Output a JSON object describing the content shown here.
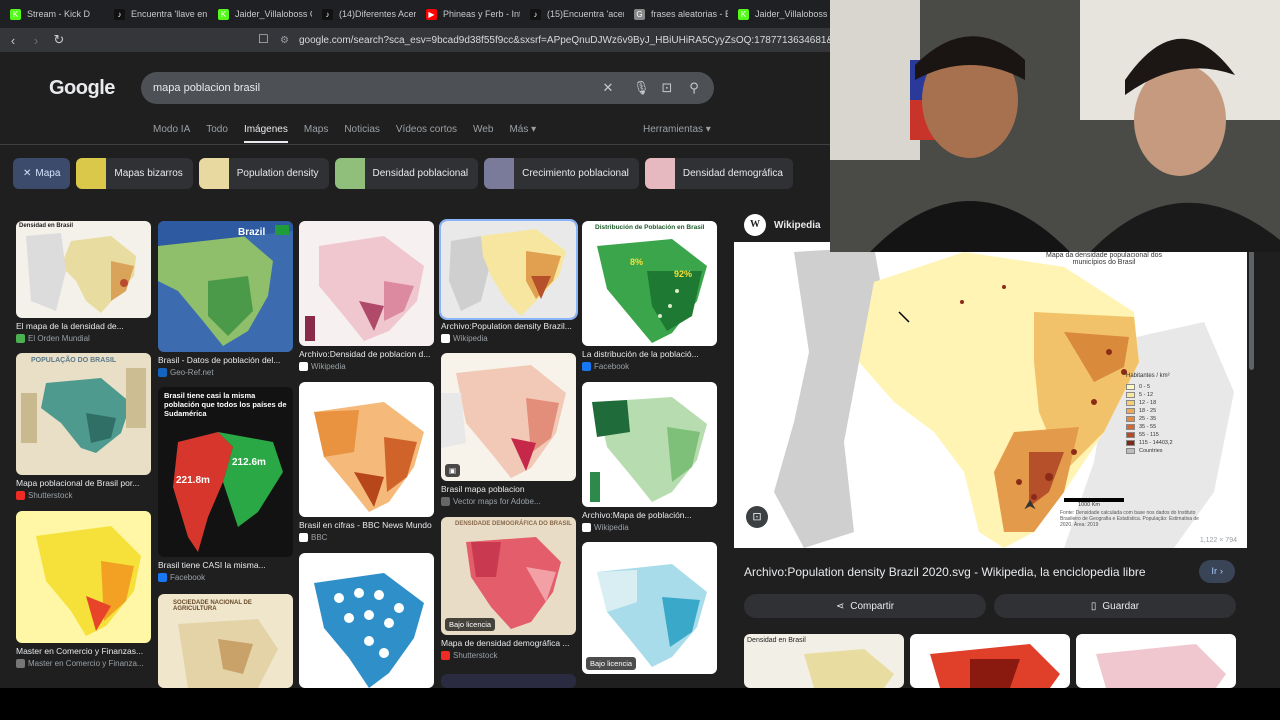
{
  "browser": {
    "tabs": [
      {
        "label": "Stream - Kick D",
        "color": "#53fc18",
        "glyph": "K"
      },
      {
        "label": "Encuentra 'llave en",
        "color": "#111",
        "glyph": "♪"
      },
      {
        "label": "Jaider_Villaloboss C",
        "color": "#53fc18",
        "glyph": "K"
      },
      {
        "label": "(14)Diferentes Acer",
        "color": "#111",
        "glyph": "♪"
      },
      {
        "label": "Phineas y Ferb - Int",
        "color": "#ff0000",
        "glyph": "▶"
      },
      {
        "label": "(15)Encuentra 'acer",
        "color": "#111",
        "glyph": "♪"
      },
      {
        "label": "frases aleatorias - B",
        "color": "#888",
        "glyph": "G"
      },
      {
        "label": "Jaider_Villaloboss C",
        "color": "#53fc18",
        "glyph": "K"
      }
    ],
    "url": "google.com/search?sca_esv=9bcad9d38f55f9cc&sxsrf=APpeQnuDJWz6v9ByJ_HBiUHiRA5CyyZsOQ:1787713634681&q=mapa+p"
  },
  "google": {
    "logo": "Google",
    "query": "mapa poblacion brasil",
    "tabs": [
      "Modo IA",
      "Todo",
      "Imágenes",
      "Maps",
      "Noticias",
      "Vídeos cortos",
      "Web",
      "Más ▾"
    ],
    "active_tab": "Imágenes",
    "tools": "Herramientas ▾",
    "chips": [
      {
        "label": "Mapa",
        "active": true
      },
      {
        "label": "Mapas bizarros",
        "thumb": "#d9c84a"
      },
      {
        "label": "Population density",
        "thumb": "#e8d9a0"
      },
      {
        "label": "Densidad poblacional",
        "thumb": "#8fbf7a"
      },
      {
        "label": "Crecimiento poblacional",
        "thumb": "#7a7a9a"
      },
      {
        "label": "Densidad demográfica",
        "thumb": "#e6b8c0"
      }
    ]
  },
  "results": [
    {
      "title": "El mapa de la densidad de...",
      "source": "El Orden Mundial",
      "src_color": "#4caf50"
    },
    {
      "title": "Brasil - Datos de población del...",
      "source": "Geo-Ref.net",
      "src_color": "#1565c0"
    },
    {
      "title": "Archivo:Densidad de poblacion d...",
      "source": "Wikipedia",
      "src_color": "#ffffff"
    },
    {
      "title": "Archivo:Population density Brazil...",
      "source": "Wikipedia",
      "src_color": "#ffffff"
    },
    {
      "title": "La distribución de la població...",
      "source": "Facebook",
      "src_color": "#1877f2"
    },
    {
      "title": "Mapa poblacional de Brasil por...",
      "source": "Shutterstock",
      "src_color": "#ee2b24"
    },
    {
      "title": "Brasil tiene CASI la misma...",
      "source": "Facebook",
      "src_color": "#1877f2"
    },
    {
      "title": "Brasil en cifras - BBC News Mundo",
      "source": "BBC",
      "src_color": "#ffffff"
    },
    {
      "title": "Brasil mapa poblacion",
      "source": "Vector maps for Adobe...",
      "src_color": "#666666"
    },
    {
      "title": "Archivo:Mapa de población...",
      "source": "Wikipedia",
      "src_color": "#ffffff"
    },
    {
      "title": "Master en Comercio y Finanzas...",
      "source": "Master en Comercio y Finanza...",
      "src_color": "#777777"
    },
    {
      "title": "Mapa de densidad demográfica ...",
      "source": "Shutterstock",
      "src_color": "#ee2b24"
    }
  ],
  "overlays": {
    "license": "Bajo licencia",
    "brazil_label": "Brazil",
    "sa_title": "Brasil tiene casi la misma población que todos los países de Sudamérica",
    "sa_left": "221.8m",
    "sa_right": "212.6m",
    "distrib_title": "Distribución de Población en Brasil",
    "dist_a": "8%",
    "dist_b": "92%",
    "densidad_title": "Densidad en Brasil",
    "poblacao_title": "POPULAÇÃO DO BRASIL",
    "dens_demo": "DENSIDADE DEMOGRÁFICA DO BRASIL",
    "sociedade": "SOCIEDADE NACIONAL DE AGRICULTURA"
  },
  "panel": {
    "source": "Wikipedia",
    "map_title": "Mapa da densidade populacional dos municípios do Brasil",
    "legend_title": "Habitantes / km²",
    "legend": [
      {
        "label": "0 - 5",
        "color": "#fff9c4"
      },
      {
        "label": "5 - 12",
        "color": "#f9e79f"
      },
      {
        "label": "12 - 18",
        "color": "#f5cf72"
      },
      {
        "label": "18 - 25",
        "color": "#eeab57"
      },
      {
        "label": "25 - 35",
        "color": "#e08a45"
      },
      {
        "label": "35 - 55",
        "color": "#cf6a36"
      },
      {
        "label": "55 - 115",
        "color": "#b54a27"
      },
      {
        "label": "115 - 14403,2",
        "color": "#7a2a17"
      },
      {
        "label": "Countries",
        "color": "#bdbdbd"
      }
    ],
    "footnote": "Fonte: Densidade calculada com base nos dados do Instituto Brasileiro de Geografia e Estatística. População: Estimativa de 2020. Área: 2019",
    "scale": "1000 Km",
    "dims": "1,122 × 794",
    "title": "Archivo:Population density Brazil 2020.svg - Wikipedia, la enciclopedia libre",
    "ir": "Ir ›",
    "share": "Compartir",
    "save": "Guardar",
    "related_label": "Densidad en Brasil"
  }
}
